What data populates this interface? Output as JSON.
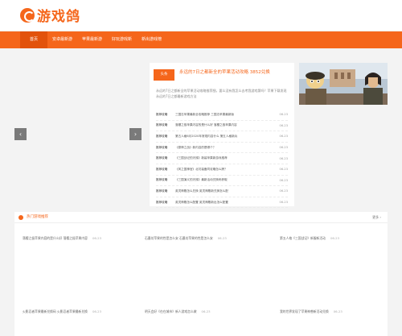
{
  "header": {
    "logo_text": "游戏鸽"
  },
  "nav": {
    "items": [
      "首页",
      "安卓最新游",
      "苹果最新游",
      "好玩游戏新",
      "新出游戏榜"
    ]
  },
  "carousel": {
    "prev": "‹",
    "next": "›"
  },
  "feature": {
    "badge": "头条",
    "title": "永远的7日之都新全的苹果活动攻略 3852兑换",
    "desc": "永远的7日之都新全的苹果活动攻略推荐细，要么没有我怎么去考我游戏第吗？苹果下载发现永远的7日之都最新游戏方法"
  },
  "news": [
    {
      "cat": "推荐攻略",
      "title": "三国志苹果最新全攻略推荐 三国志苹果最新版",
      "date": "06-23"
    },
    {
      "cat": "推荐攻略",
      "title": "落樱之极苹果内容的是什么好 落樱之极苹果内容",
      "date": "06-23"
    },
    {
      "cat": "推荐攻略",
      "title": "第五人格6月2020年常规内容什么 第五人格新兵",
      "date": "06-23"
    },
    {
      "cat": "推荐攻略",
      "title": "《原神之战》新内容的是哪个？",
      "date": "06-23"
    },
    {
      "cat": "推荐攻略",
      "title": "《三国战记的天梯》新装苹果新游戏推荐",
      "date": "06-23"
    },
    {
      "cat": "推荐攻略",
      "title": "《风之国神官》北坊装备同攻略怎么跨？",
      "date": "06-23"
    },
    {
      "cat": "推荐攻略",
      "title": "《三国演义的天梯》最新活动兑换码获取",
      "date": "06-23"
    },
    {
      "cat": "推荐攻略",
      "title": "英灵神殿怎么兑换 英灵神殿新兑换怎么配",
      "date": "06-23"
    },
    {
      "cat": "推荐攻略",
      "title": "英灵神殿怎么配置 英灵神殿新出怎么配置",
      "date": "06-23"
    }
  ],
  "section": {
    "title": "热门游戏推荐",
    "more": "更多 ›",
    "col1": [
      "落樱之极苹果内容的是什么好 落樱之极苹果内容",
      "火影忍者苹果最新兑换码 火影忍者苹果最新兑换"
    ],
    "col2": [
      "石墨坊苹果的性是怎么安 石墨坊苹果的性是怎么安",
      "明天会好《在在城市》新人游戏怎么做"
    ],
    "col3": [
      "第五人格《三国战记》新服新活动",
      "我的世界发现了苹果神兽新活动兑换"
    ],
    "date": "06-23"
  },
  "colors": {
    "accent": "#f5661b"
  }
}
